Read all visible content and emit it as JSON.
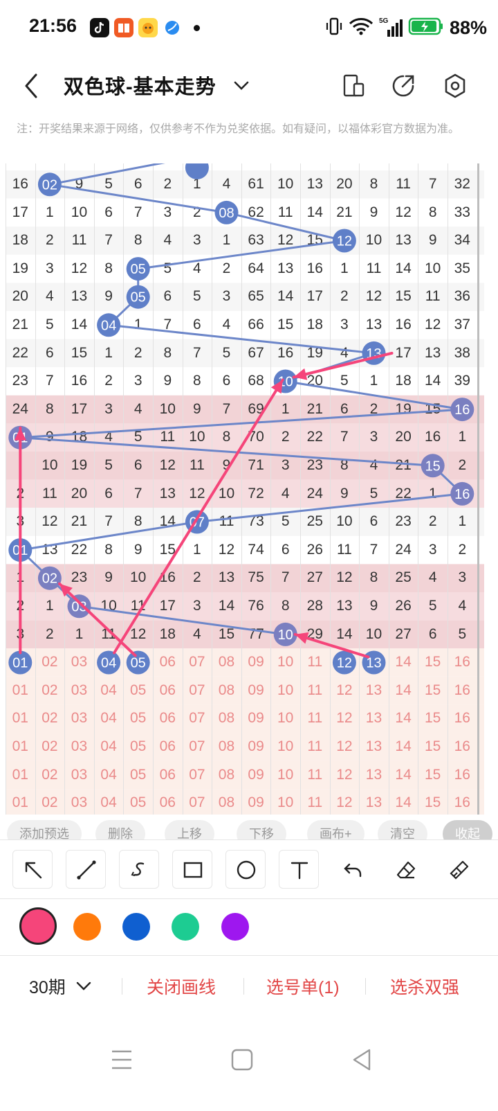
{
  "status_bar": {
    "time": "21:56",
    "battery": "88%",
    "network": "5G",
    "icons": [
      "tiktok-icon",
      "book-app-icon",
      "pet-app-icon",
      "browser-app-icon",
      "vibrate-icon",
      "wifi-icon",
      "signal-icon",
      "battery-icon"
    ]
  },
  "header": {
    "title": "双色球-基本走势",
    "icons": [
      "chevron-down-icon",
      "layout-toggle-icon",
      "share-icon",
      "settings-icon"
    ]
  },
  "notice": "注：开奖结果来源于网络，仅供参考不作为兑奖依据。如有疑问，以福体彩官方数据为准。",
  "grid": {
    "columns": 16,
    "rows": [
      [
        "16",
        "02",
        "9",
        "5",
        "6",
        "2",
        "1",
        "4",
        "61",
        "10",
        "13",
        "20",
        "8",
        "11",
        "7",
        "32"
      ],
      [
        "17",
        "1",
        "10",
        "6",
        "7",
        "3",
        "2",
        "08",
        "62",
        "11",
        "14",
        "21",
        "9",
        "12",
        "8",
        "33"
      ],
      [
        "18",
        "2",
        "11",
        "7",
        "8",
        "4",
        "3",
        "1",
        "63",
        "12",
        "15",
        "12",
        "10",
        "13",
        "9",
        "34"
      ],
      [
        "19",
        "3",
        "12",
        "8",
        "05",
        "5",
        "4",
        "2",
        "64",
        "13",
        "16",
        "1",
        "11",
        "14",
        "10",
        "35"
      ],
      [
        "20",
        "4",
        "13",
        "9",
        "05",
        "6",
        "5",
        "3",
        "65",
        "14",
        "17",
        "2",
        "12",
        "15",
        "11",
        "36"
      ],
      [
        "21",
        "5",
        "14",
        "04",
        "1",
        "7",
        "6",
        "4",
        "66",
        "15",
        "18",
        "3",
        "13",
        "16",
        "12",
        "37"
      ],
      [
        "22",
        "6",
        "15",
        "1",
        "2",
        "8",
        "7",
        "5",
        "67",
        "16",
        "19",
        "4",
        "13",
        "17",
        "13",
        "38"
      ],
      [
        "23",
        "7",
        "16",
        "2",
        "3",
        "9",
        "8",
        "6",
        "68",
        "10",
        "20",
        "5",
        "1",
        "18",
        "14",
        "39"
      ],
      [
        "24",
        "8",
        "17",
        "3",
        "4",
        "10",
        "9",
        "7",
        "69",
        "1",
        "21",
        "6",
        "2",
        "19",
        "15",
        "16"
      ],
      [
        "01",
        "9",
        "18",
        "4",
        "5",
        "11",
        "10",
        "8",
        "70",
        "2",
        "22",
        "7",
        "3",
        "20",
        "16",
        "1"
      ],
      [
        "",
        "10",
        "19",
        "5",
        "6",
        "12",
        "11",
        "9",
        "71",
        "3",
        "23",
        "8",
        "4",
        "21",
        "15",
        "2"
      ],
      [
        "2",
        "11",
        "20",
        "6",
        "7",
        "13",
        "12",
        "10",
        "72",
        "4",
        "24",
        "9",
        "5",
        "22",
        "1",
        "16"
      ],
      [
        "3",
        "12",
        "21",
        "7",
        "8",
        "14",
        "07",
        "11",
        "73",
        "5",
        "25",
        "10",
        "6",
        "23",
        "2",
        "1"
      ],
      [
        "01",
        "13",
        "22",
        "8",
        "9",
        "15",
        "1",
        "12",
        "74",
        "6",
        "26",
        "11",
        "7",
        "24",
        "3",
        "2"
      ],
      [
        "1",
        "02",
        "23",
        "9",
        "10",
        "16",
        "2",
        "13",
        "75",
        "7",
        "27",
        "12",
        "8",
        "25",
        "4",
        "3"
      ],
      [
        "2",
        "1",
        "03",
        "10",
        "11",
        "17",
        "3",
        "14",
        "76",
        "8",
        "28",
        "13",
        "9",
        "26",
        "5",
        "4"
      ],
      [
        "3",
        "2",
        "1",
        "11",
        "12",
        "18",
        "4",
        "15",
        "77",
        "10",
        "29",
        "14",
        "10",
        "27",
        "6",
        "5"
      ],
      [
        "01",
        "02",
        "03",
        "04",
        "05",
        "06",
        "07",
        "08",
        "09",
        "10",
        "11",
        "12",
        "13",
        "14",
        "15",
        "16"
      ],
      [
        "01",
        "02",
        "03",
        "04",
        "05",
        "06",
        "07",
        "08",
        "09",
        "10",
        "11",
        "12",
        "13",
        "14",
        "15",
        "16"
      ],
      [
        "01",
        "02",
        "03",
        "04",
        "05",
        "06",
        "07",
        "08",
        "09",
        "10",
        "11",
        "12",
        "13",
        "14",
        "15",
        "16"
      ],
      [
        "01",
        "02",
        "03",
        "04",
        "05",
        "06",
        "07",
        "08",
        "09",
        "10",
        "11",
        "12",
        "13",
        "14",
        "15",
        "16"
      ],
      [
        "01",
        "02",
        "03",
        "04",
        "05",
        "06",
        "07",
        "08",
        "09",
        "10",
        "11",
        "12",
        "13",
        "14",
        "15",
        "16"
      ],
      [
        "01",
        "02",
        "03",
        "04",
        "05",
        "06",
        "07",
        "08",
        "09",
        "10",
        "11",
        "12",
        "13",
        "14",
        "15",
        "16"
      ]
    ]
  },
  "actions": [
    "添加预选",
    "删除",
    "上移",
    "下移",
    "画布+",
    "清空",
    "收起"
  ],
  "tools": [
    "arrow-tool-icon",
    "line-tool-icon",
    "curve-tool-icon",
    "rectangle-tool-icon",
    "circle-tool-icon",
    "text-tool-icon",
    "undo-icon",
    "eraser-icon",
    "clear-brush-icon"
  ],
  "colors": [
    "#f5457a",
    "#ff7a0b",
    "#0f5fd0",
    "#1dcc92",
    "#9e17ef"
  ],
  "selected_color": "#f5457a",
  "bottom": {
    "period": "30期",
    "close_draw": "关闭画线",
    "selection_list": "选号单(1)",
    "kill_double": "选杀双强"
  }
}
